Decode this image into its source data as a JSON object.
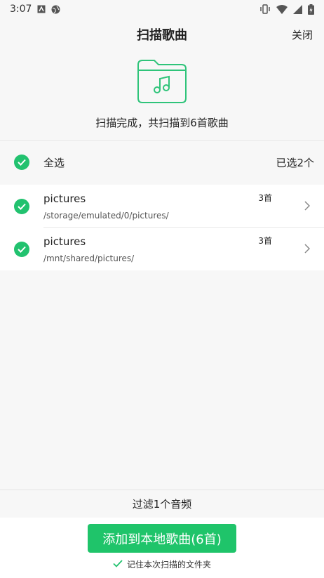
{
  "status_bar": {
    "time": "3:07",
    "icons_left": [
      "a-box-icon",
      "globe-icon"
    ],
    "icons_right": [
      "vibrate-icon",
      "wifi-icon",
      "signal-icon",
      "battery-charging-icon"
    ]
  },
  "header": {
    "title": "扫描歌曲",
    "close_label": "关闭"
  },
  "scan_result": {
    "message": "扫描完成，共扫描到6首歌曲"
  },
  "select_all": {
    "label": "全选",
    "selected_count": "已选2个"
  },
  "folders": [
    {
      "name": "pictures",
      "path": "/storage/emulated/0/pictures/",
      "count": "3首"
    },
    {
      "name": "pictures",
      "path": "/mnt/shared/pictures/",
      "count": "3首"
    }
  ],
  "footer": {
    "filter_text": "过滤1个音频",
    "add_button": "添加到本地歌曲(6首)",
    "remember_text": "记住本次扫描的文件夹"
  },
  "colors": {
    "accent": "#1fc46a",
    "check": "#22c26f",
    "folder_outline": "#2fc47a"
  }
}
